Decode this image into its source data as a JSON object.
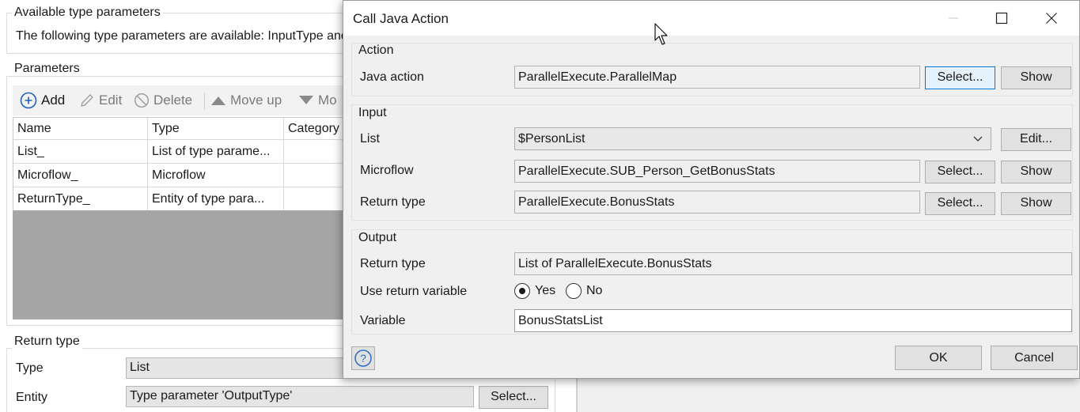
{
  "editor": {
    "type_params": {
      "title": "Available type parameters",
      "description": "The following type parameters are available: InputType and"
    },
    "parameters": {
      "title": "Parameters",
      "toolbar": {
        "add": "Add",
        "edit": "Edit",
        "delete": "Delete",
        "move_up": "Move up",
        "move_down": "Mo"
      },
      "columns": [
        "Name",
        "Type",
        "Category"
      ],
      "rows": [
        {
          "name": "List_",
          "type": "List of type parame...",
          "category": ""
        },
        {
          "name": "Microflow_",
          "type": "Microflow",
          "category": ""
        },
        {
          "name": "ReturnType_",
          "type": "Entity of type para...",
          "category": ""
        }
      ]
    },
    "return_type": {
      "title": "Return type",
      "type_label": "Type",
      "type_value": "List",
      "entity_label": "Entity",
      "entity_value": "Type parameter 'OutputType'",
      "select_button": "Select..."
    }
  },
  "dialog": {
    "title": "Call Java Action",
    "action": {
      "title": "Action",
      "java_action_label": "Java action",
      "java_action_value": "ParallelExecute.ParallelMap",
      "select_button": "Select...",
      "show_button": "Show"
    },
    "input": {
      "title": "Input",
      "list_label": "List",
      "list_value": "$PersonList",
      "edit_button": "Edit...",
      "microflow_label": "Microflow",
      "microflow_value": "ParallelExecute.SUB_Person_GetBonusStats",
      "return_type_label": "Return type",
      "return_type_value": "ParallelExecute.BonusStats",
      "select_button": "Select...",
      "show_button": "Show"
    },
    "output": {
      "title": "Output",
      "return_type_label": "Return type",
      "return_type_value": "List of ParallelExecute.BonusStats",
      "use_return_label": "Use return variable",
      "yes_label": "Yes",
      "no_label": "No",
      "variable_label": "Variable",
      "variable_value": "BonusStatsList"
    },
    "ok_button": "OK",
    "cancel_button": "Cancel"
  },
  "colors": {
    "focus_border": "#0078d7",
    "add_icon": "#1e5fb4",
    "grid_empty_area": "#a6a6a6"
  }
}
